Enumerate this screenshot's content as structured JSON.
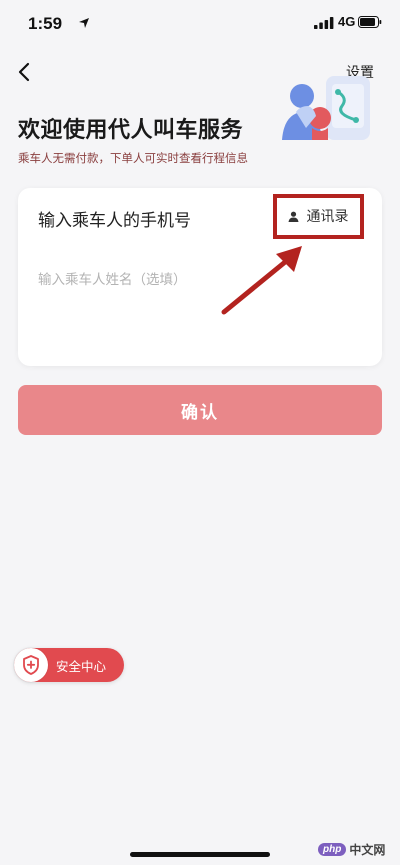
{
  "status_bar": {
    "time": "1:59",
    "network": "4G"
  },
  "nav": {
    "settings_label": "设置"
  },
  "header": {
    "title": "欢迎使用代人叫车服务",
    "subtitle": "乘车人无需付款，下单人可实时查看行程信息"
  },
  "form": {
    "phone_placeholder": "输入乘车人的手机号",
    "contacts_label": "通讯录",
    "name_placeholder": "输入乘车人姓名（选填）"
  },
  "actions": {
    "confirm_label": "确认"
  },
  "safety": {
    "label": "安全中心"
  },
  "watermark": {
    "logo": "php",
    "text": "中文网"
  },
  "colors": {
    "accent_red": "#e14a4f",
    "confirm_disabled": "#e9878a",
    "annotation_red": "#b3231f"
  },
  "icons": {
    "back": "chevron-left-icon",
    "contacts": "person-icon",
    "safety": "shield-plus-icon"
  }
}
